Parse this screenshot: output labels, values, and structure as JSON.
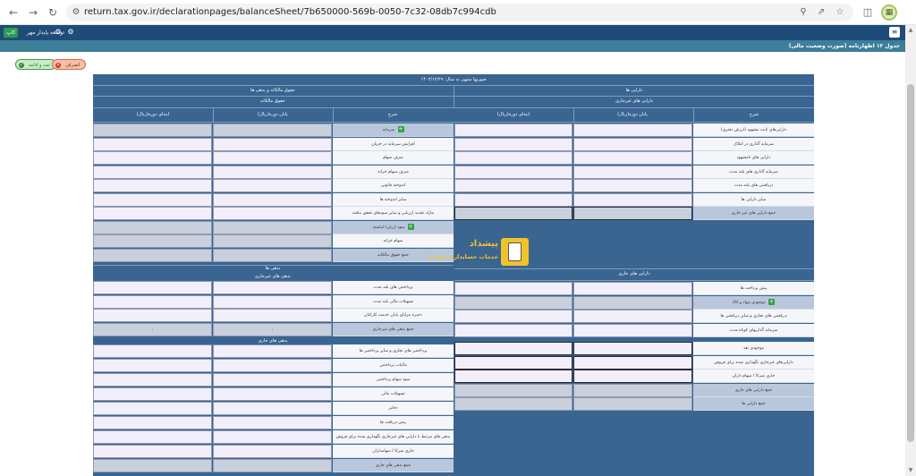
{
  "browser": {
    "url": "return.tax.gov.ir/declarationpages/balanceSheet/7b650000-569b-0050-7c32-08db7c994cdb"
  },
  "site_header": {
    "badge": "کاپ",
    "user_text": "توسعه پایدار مهر"
  },
  "section_title": "جدول ۱۲ اظهارنامه (صورت وضعیت مالی)",
  "actions": {
    "cancel_label": "انصراف",
    "save_label": "ثبت و ادامه"
  },
  "table": {
    "title": "صورتها منتهی به سال: ۱۴۰۲/۱۲/۲۹",
    "right_header": "دارایی ها",
    "right_sub": "دارایی های غیرجاری",
    "left_header": "حقوق مالکانه و بدهی ها",
    "left_sub": "حقوق مالکانه",
    "col_desc": "شرح",
    "col_end": "پایان دوره(ریال)",
    "col_start": "ابتدای دوره(ریال)",
    "current_assets_header": "دارایی های جاری",
    "liabilities_header": "بدهی ها",
    "noncurrent_liab_header": "بدهی های غیرجاری",
    "current_liab_header": "بدهی های جاری",
    "right_rows_noncurrent": [
      "دارایی‌های ثابت مشهود (ارزش دفتری)",
      "سرمایه گذاری در املاک",
      "دارایی های نامشهود",
      "سرمایه گذاری های بلند مدت",
      "دریافتنی های بلند مدت",
      "سایر دارایی ها",
      "جمع دارایی های غیر جاری"
    ],
    "right_rows_current": [
      "پیش پرداخت ها",
      "موجودی مواد و کالا",
      "دریافتنی های تجاری و سایر دریافتنی ها",
      "سرمایه گذاریهای کوتاه مدت",
      "موجودی نقد",
      "دارایی‌های غیرجاری نگهداری شده برای فروش",
      "جاری شرکا / سهام داران",
      "جمع دارایی های جاری",
      "جمع دارایی ها"
    ],
    "left_rows_equity": [
      "سرمایه",
      "افزایش سرمایه در جریان",
      "صرف سهام",
      "صرف سهام خزانه",
      "اندوخته قانونی",
      "سایر اندوخته ها",
      "مازاد تجدید ارزیابی و سایر سودهای تحقق نیافته",
      "سود (زیان) انباشته",
      "سهام خزانه",
      "جمع حقوق مالکانه"
    ],
    "left_rows_noncurrent_liab": [
      "پرداختنی های بلند مدت",
      "تسهیلات مالی بلند مدت",
      "ذخیره مزایای پایان خدمت کارکنان",
      "جمع بدهی های غیرجاری"
    ],
    "left_rows_current_liab": [
      "پرداختنی های تجاری و سایر پرداختنی ها",
      "مالیات پرداختنی",
      "سود سهام پرداختنی",
      "تسهیلات مالی",
      "ذخایر",
      "پیش دریافت ها",
      "بدهی های مرتبط با دارایی های غیرجاری نگهداری شده برای فروش",
      "جاری شرکا / سهامداران",
      "جمع بدهی های جاری"
    ],
    "zero_value": "۰"
  },
  "watermark": {
    "title": "پیشداد",
    "subtitle": "خدمات حسابداری پیشداد"
  },
  "colors": {
    "header": "#1e4c78",
    "section": "#3d7e99",
    "panel": "#3a6591"
  }
}
